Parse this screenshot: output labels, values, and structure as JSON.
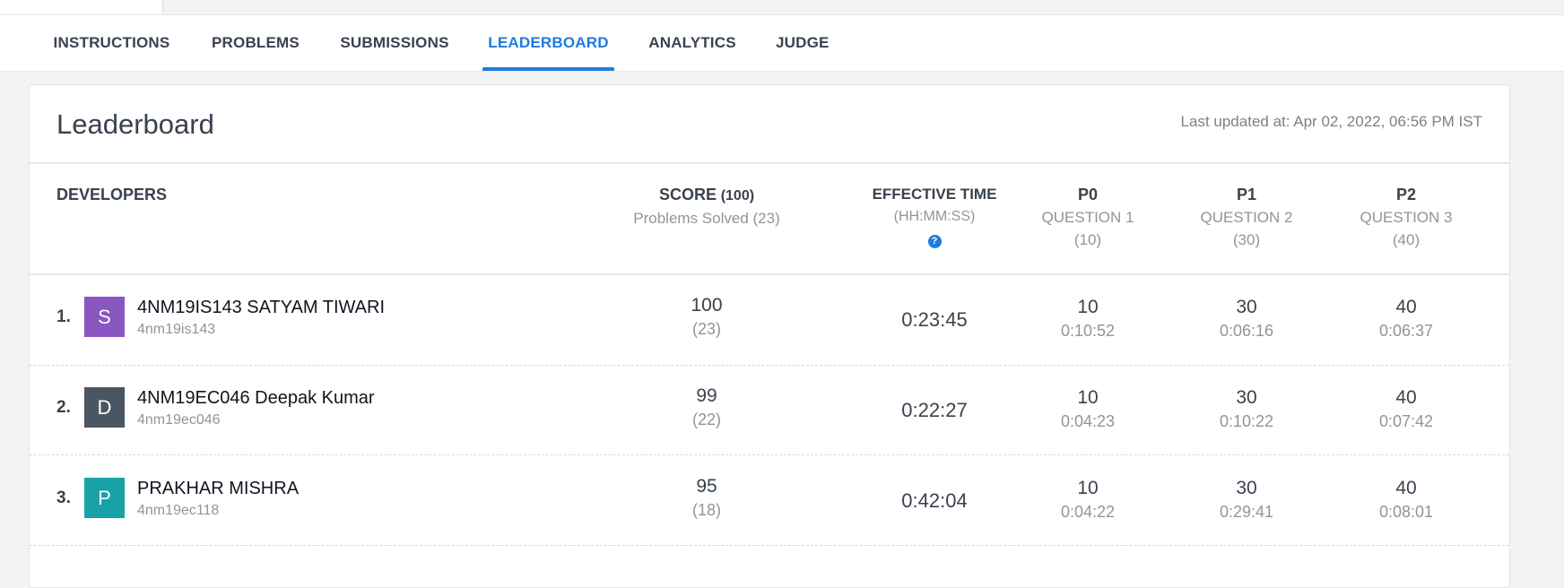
{
  "tabs": [
    {
      "label": "INSTRUCTIONS",
      "active": false
    },
    {
      "label": "PROBLEMS",
      "active": false
    },
    {
      "label": "SUBMISSIONS",
      "active": false
    },
    {
      "label": "LEADERBOARD",
      "active": true
    },
    {
      "label": "ANALYTICS",
      "active": false
    },
    {
      "label": "JUDGE",
      "active": false
    }
  ],
  "leaderboard": {
    "title": "Leaderboard",
    "last_updated": "Last updated at: Apr 02, 2022, 06:56 PM IST",
    "headers": {
      "developers": "DEVELOPERS",
      "score": "SCORE",
      "score_max": "(100)",
      "problems_solved": "Problems Solved (23)",
      "effective_time": "EFFECTIVE TIME",
      "time_format": "(HH:MM:SS)",
      "help_icon_glyph": "?",
      "problems": [
        {
          "code": "P0",
          "name": "QUESTION 1",
          "points": "(10)"
        },
        {
          "code": "P1",
          "name": "QUESTION 2",
          "points": "(30)"
        },
        {
          "code": "P2",
          "name": "QUESTION 3",
          "points": "(40)"
        }
      ]
    },
    "rows": [
      {
        "rank": "1.",
        "avatar_letter": "S",
        "avatar_color": "#8a56c2",
        "name": "4NM19IS143 SATYAM TIWARI",
        "handle": "4nm19is143",
        "score": "100",
        "solved": "(23)",
        "effective_time": "0:23:45",
        "problems": [
          {
            "score": "10",
            "time": "0:10:52"
          },
          {
            "score": "30",
            "time": "0:06:16"
          },
          {
            "score": "40",
            "time": "0:06:37"
          }
        ]
      },
      {
        "rank": "2.",
        "avatar_letter": "D",
        "avatar_color": "#4a5662",
        "name": "4NM19EC046 Deepak Kumar",
        "handle": "4nm19ec046",
        "score": "99",
        "solved": "(22)",
        "effective_time": "0:22:27",
        "problems": [
          {
            "score": "10",
            "time": "0:04:23"
          },
          {
            "score": "30",
            "time": "0:10:22"
          },
          {
            "score": "40",
            "time": "0:07:42"
          }
        ]
      },
      {
        "rank": "3.",
        "avatar_letter": "P",
        "avatar_color": "#17a2a8",
        "name": "PRAKHAR MISHRA",
        "handle": "4nm19ec118",
        "score": "95",
        "solved": "(18)",
        "effective_time": "0:42:04",
        "problems": [
          {
            "score": "10",
            "time": "0:04:22"
          },
          {
            "score": "30",
            "time": "0:29:41"
          },
          {
            "score": "40",
            "time": "0:08:01"
          }
        ]
      }
    ]
  }
}
